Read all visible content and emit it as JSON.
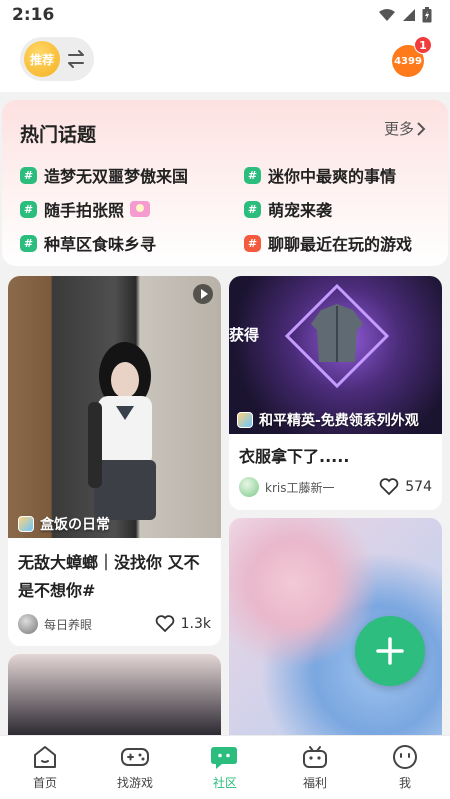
{
  "status": {
    "time": "2:16"
  },
  "header": {
    "feed_tab_label": "推荐",
    "brand_logo_text": "4399",
    "notification_count": "1"
  },
  "topics": {
    "title": "热门话题",
    "more_label": "更多",
    "items": [
      {
        "label": "造梦无双噩梦傲来国",
        "icon": "hashtag-icon"
      },
      {
        "label": "迷你中最爽的事情",
        "icon": "hashtag-icon"
      },
      {
        "label": "随手拍张照",
        "icon": "hashtag-icon"
      },
      {
        "label": "萌宠来袭",
        "icon": "hashtag-icon"
      },
      {
        "label": "种草区食味乡寻",
        "icon": "hashtag-icon"
      },
      {
        "label": "聊聊最近在玩的游戏",
        "icon": "hashtag-hot-icon"
      }
    ]
  },
  "feed": {
    "posts": [
      {
        "game_label": "盒饭の日常",
        "title_line1": "无敌大蟑螂｜没找你 又不",
        "title_line2": "是不想你#",
        "author": "每日养眼",
        "likes": "1.3k"
      },
      {
        "game_label": "和平精英-免费领系列外观",
        "image_caption": "获得",
        "title": "衣服拿下了.....",
        "author": "kris工藤新一",
        "likes": "574"
      }
    ]
  },
  "bottom_nav": {
    "items": [
      {
        "label": "首页"
      },
      {
        "label": "找游戏"
      },
      {
        "label": "社区"
      },
      {
        "label": "福利"
      },
      {
        "label": "我"
      }
    ],
    "active_index": 2
  },
  "colors": {
    "accent_green": "#2bbd7e",
    "hot_red": "#f45a3e",
    "badge_red": "#f23c3c",
    "brand_orange": "#ff7a1a"
  }
}
